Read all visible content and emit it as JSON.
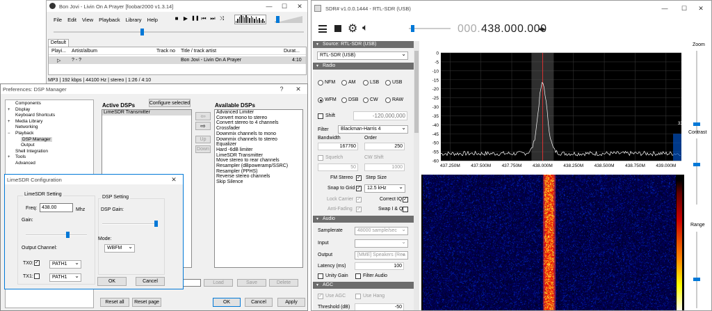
{
  "foobar": {
    "title": "Bon Jovi - Livin On A Prayer  [foobar2000 v1.3.14]",
    "menu": [
      "File",
      "Edit",
      "View",
      "Playback",
      "Library",
      "Help"
    ],
    "transport": [
      "■",
      "▶",
      "❚❚",
      "⏮",
      "⏭",
      "⤨"
    ],
    "tab": "Default",
    "columns": [
      "Playi...",
      "Artist/album",
      "Track no",
      "Title / track artist",
      "Durat..."
    ],
    "row": {
      "playing": "▷",
      "artist": "? - ?",
      "track": "",
      "title": "Bon Jovi - Livin On A Prayer",
      "duration": "4:10"
    },
    "status": "MP3 | 192 kbps | 44100 Hz | stereo | 1:26 / 4:10"
  },
  "dsp": {
    "title": "Preferences: DSP Manager",
    "help": "?",
    "tree": [
      {
        "label": "Components",
        "indent": 1
      },
      {
        "label": "Display",
        "indent": 0,
        "exp": "+"
      },
      {
        "label": "Keyboard Shortcuts",
        "indent": 1
      },
      {
        "label": "Media Library",
        "indent": 0,
        "exp": "+"
      },
      {
        "label": "Networking",
        "indent": 1
      },
      {
        "label": "Playback",
        "indent": 0,
        "exp": "−"
      },
      {
        "label": "DSP Manager",
        "indent": 2,
        "sel": true
      },
      {
        "label": "Output",
        "indent": 2
      },
      {
        "label": "Shell Integration",
        "indent": 1
      },
      {
        "label": "Tools",
        "indent": 0,
        "exp": "+"
      },
      {
        "label": "Advanced",
        "indent": 1
      }
    ],
    "active_title": "Active DSPs",
    "configure": "Configure selected",
    "active_list": [
      "LimeSDR Transmitter"
    ],
    "available_title": "Available DSPs",
    "available_list": [
      "Advanced Limiter",
      "Convert mono to stereo",
      "Convert stereo to 4 channels",
      "Crossfader",
      "Downmix channels to mono",
      "Downmix channels to stereo",
      "Equalizer",
      "Hard -6dB limiter",
      "LimeSDR Transmitter",
      "Move stereo to rear channels",
      "Resampler (dBpoweramp/SSRC)",
      "Resampler (PPHS)",
      "Reverse stereo channels",
      "Skip Silence"
    ],
    "arrow_left": "⇦",
    "arrow_right": "⇨",
    "up": "Up",
    "down": "Down",
    "load": "Load",
    "save": "Save",
    "delete": "Delete",
    "reset_all": "Reset all",
    "reset_page": "Reset page",
    "ok": "OK",
    "cancel": "Cancel",
    "apply": "Apply"
  },
  "lime": {
    "title": "LimeSDR Configuration",
    "setting": "LimeSDR Setting",
    "freq_label": "Freq:",
    "freq": "438.00",
    "unit": "Mhz",
    "gain": "Gain:",
    "gain_level": 0.7,
    "output_channel": "Output Channel:",
    "tx0": "TX0:",
    "tx1": "TX1:",
    "tx0_path": "PATH1",
    "tx1_path": "PATH1",
    "dsp_setting": "DSP Setting",
    "dsp_gain": "DSP Gain:",
    "dsp_gain_level": 1.0,
    "mode_label": "Mode:",
    "mode": "WBFM",
    "ok": "OK",
    "cancel": "Cancel"
  },
  "sdr": {
    "title": "SDR# v1.0.0.1444 - RTL-SDR (USB)",
    "freq_dim": "000.",
    "freq": "438.000.000",
    "source_header": "Source: RTL-SDR (USB)",
    "source": "RTL-SDR (USB)",
    "radio_header": "Radio",
    "modes_row1": [
      "NFM",
      "AM",
      "LSB",
      "USB"
    ],
    "modes_row2": [
      "WFM",
      "DSB",
      "CW",
      "RAW"
    ],
    "selected_mode": "WFM",
    "shift_label": "Shift",
    "shift": "-120,000,000",
    "filter_label": "Filter",
    "filter": "Blackman-Harris 4",
    "bandwidth_label": "Bandwidth",
    "order_label": "Order",
    "bandwidth": "167760",
    "order": "250",
    "squelch_label": "Squelch",
    "cwshift_label": "CW Shift",
    "squelch": "50",
    "cwshift": "1000",
    "fmstereo": "FM Stereo",
    "stepsize": "Step Size",
    "snap": "Snap to Grid",
    "step": "12.5 kHz",
    "lockcarrier": "Lock Carrier",
    "correctiq": "Correct IQ",
    "antifading": "Anti-Fading",
    "swapiq": "Swap I & Q",
    "audio_header": "Audio",
    "samplerate_label": "Samplerate",
    "samplerate": "48000 sample/sec",
    "input_label": "Input",
    "input": "",
    "output_label": "Output",
    "output": "[MME] Speakers (Rea",
    "latency_label": "Latency (ms)",
    "latency": "100",
    "unity": "Unity Gain",
    "filteraudio": "Filter Audio",
    "agc_header": "AGC",
    "useagc": "Use AGC",
    "usehang": "Use Hang",
    "threshold_label": "Threshold (dB)",
    "threshold": "-50",
    "zoom": "Zoom",
    "contrast": "Contrast",
    "range": "Range",
    "level_box": "33",
    "accent": "#0078d7",
    "spectrum": {
      "y_ticks": [
        0,
        -5,
        -10,
        -15,
        -20,
        -25,
        -30,
        -35,
        -40,
        -45,
        -50,
        -55,
        -60
      ],
      "x_ticks": [
        "437.250M",
        "437.500M",
        "437.750M",
        "438.000M",
        "438.250M",
        "438.500M",
        "438.750M",
        "439.000M"
      ]
    }
  }
}
